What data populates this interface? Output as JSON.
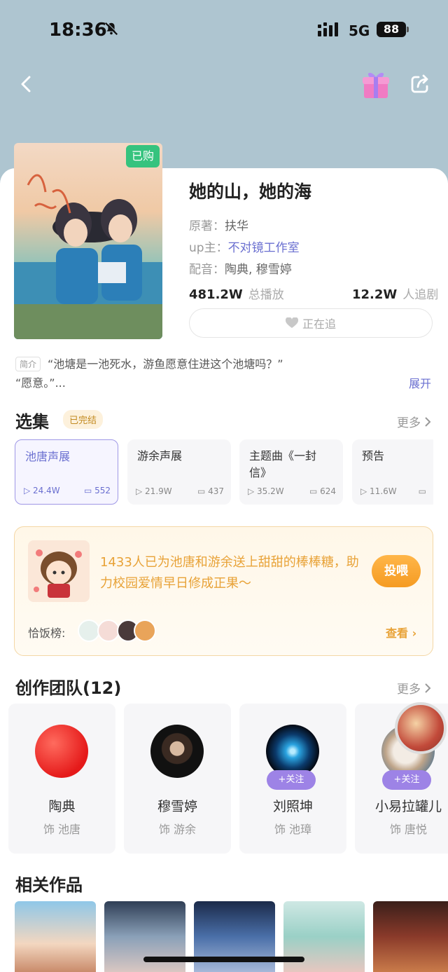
{
  "status_bar": {
    "time": "18:36",
    "network": "5G",
    "battery": "88"
  },
  "drama": {
    "title": "她的山，她的海",
    "bought_badge": "已购",
    "original_label": "原著：",
    "original_value": "扶华",
    "up_label": "up主：",
    "up_value": "不对镜工作室",
    "cv_label": "配音：",
    "cv_value": "陶典, 穆雪婷",
    "plays_value": "481.2W",
    "plays_label": "总播放",
    "followers_value": "12.2W",
    "followers_label": "人追剧",
    "follow_button": "正在追"
  },
  "intro": {
    "tag": "简介",
    "line1": "“池塘是一池死水，游鱼愿意住进这个池塘吗？”",
    "line2": "“愿意。”...",
    "expand": "展开"
  },
  "episodes": {
    "section_title": "选集",
    "status_badge": "已完结",
    "more": "更多",
    "items": [
      {
        "name": "池唐声展",
        "plays": "24.4W",
        "comments": "552"
      },
      {
        "name": "游余声展",
        "plays": "21.9W",
        "comments": "437"
      },
      {
        "name": "主题曲《一封信》",
        "plays": "35.2W",
        "comments": "624"
      },
      {
        "name": "预告",
        "plays": "11.6W",
        "comments": ""
      }
    ]
  },
  "feed": {
    "text": "1433人已为池唐和游余送上甜甜的棒棒糖，助力校园爱情早日修成正果～",
    "button": "投喂",
    "rank_label": "恰饭榜:",
    "view": "查看"
  },
  "team": {
    "section_title": "创作团队(12)",
    "more": "更多",
    "follow_label": "+关注",
    "members": [
      {
        "name": "陶典",
        "role": "饰 池唐"
      },
      {
        "name": "穆雪婷",
        "role": "饰 游余"
      },
      {
        "name": "刘照坤",
        "role": "饰 池璋"
      },
      {
        "name": "小易拉罐儿",
        "role": "饰 唐悦"
      }
    ]
  },
  "related": {
    "section_title": "相关作品"
  },
  "colors": {
    "accent": "#6a6fd0",
    "orange": "#e8a237",
    "green": "#36c37e"
  }
}
